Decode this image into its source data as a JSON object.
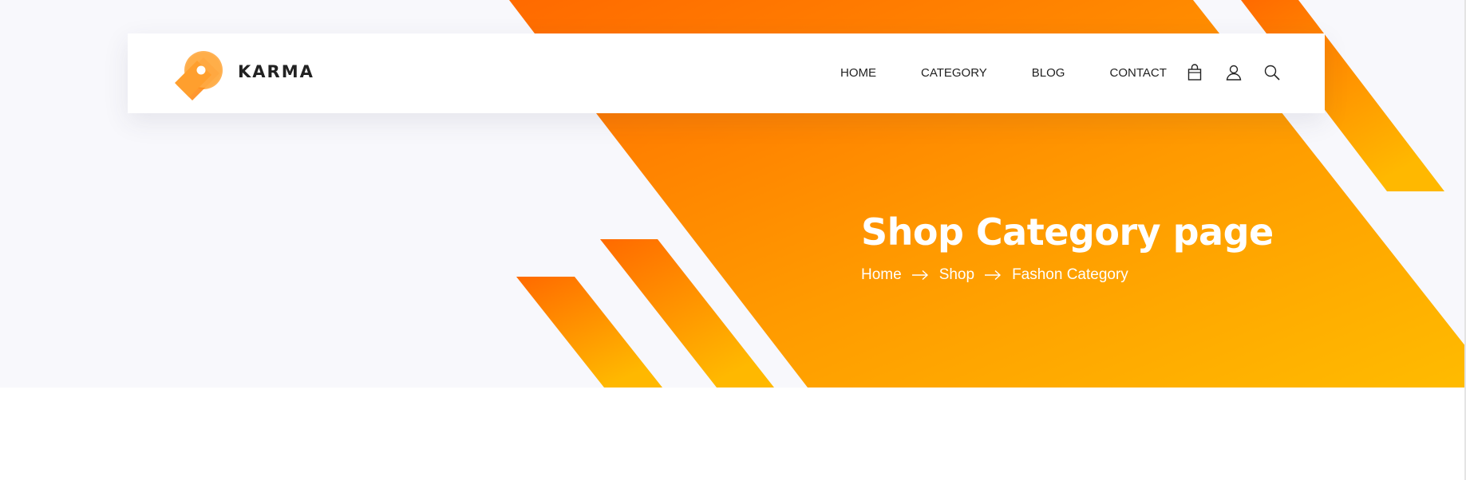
{
  "brand": {
    "name": "KARMA",
    "logo": "karma-location-pin-logo"
  },
  "nav": {
    "items": [
      {
        "label": "HOME"
      },
      {
        "label": "CATEGORY"
      },
      {
        "label": "BLOG"
      },
      {
        "label": "CONTACT"
      }
    ],
    "icons": [
      "shopping-bag-icon",
      "user-icon",
      "search-icon"
    ]
  },
  "hero": {
    "title": "Shop Category page",
    "breadcrumb": [
      "Home",
      "Shop",
      "Fashon Category"
    ],
    "gradient": {
      "from": "#ff6a00",
      "to": "#ffb800"
    }
  },
  "colors": {
    "accent_orange": "#ff6a00",
    "accent_yellow": "#ffb800",
    "text_dark": "#222222",
    "banner_bg": "#f8f8fc"
  }
}
